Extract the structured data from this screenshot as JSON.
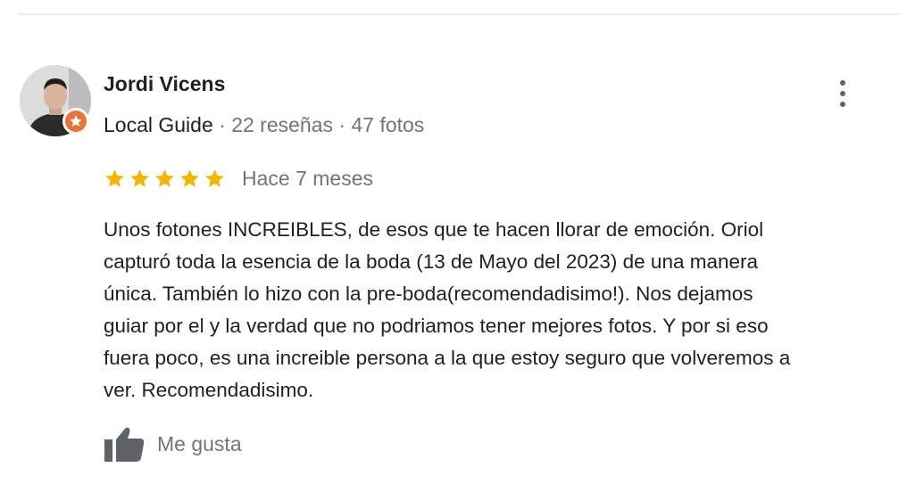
{
  "review": {
    "reviewer": {
      "name": "Jordi Vicens",
      "guide_label": "Local Guide",
      "separator": " · ",
      "reviews_count": "22 reseñas",
      "photos_count": "47 fotos"
    },
    "rating": 5,
    "max_rating": 5,
    "date": "Hace 7 meses",
    "text_lines": [
      "Unos fotones INCREIBLES, de esos que te hacen llorar de emoción. Oriol",
      "capturó toda la esencia de la boda (13 de Mayo del 2023) de una manera",
      "única. También lo hizo con la pre-boda(recomendadisimo!). Nos dejamos",
      "guiar por el y la verdad que no podriamos tener mejores fotos. Y por si eso",
      "fuera poco, es una increible persona a la que estoy seguro que volveremos a",
      "ver. Recomendadisimo."
    ],
    "like_label": "Me gusta"
  },
  "icons": {
    "more": "more-vert-icon",
    "star": "star-icon",
    "like": "thumbs-up-icon",
    "badge": "local-guide-badge-icon"
  },
  "colors": {
    "star": "#f4b400",
    "badge": "#e8743b",
    "muted_text": "#70757a",
    "main_text": "#202124",
    "icon_gray": "#5f6368"
  }
}
